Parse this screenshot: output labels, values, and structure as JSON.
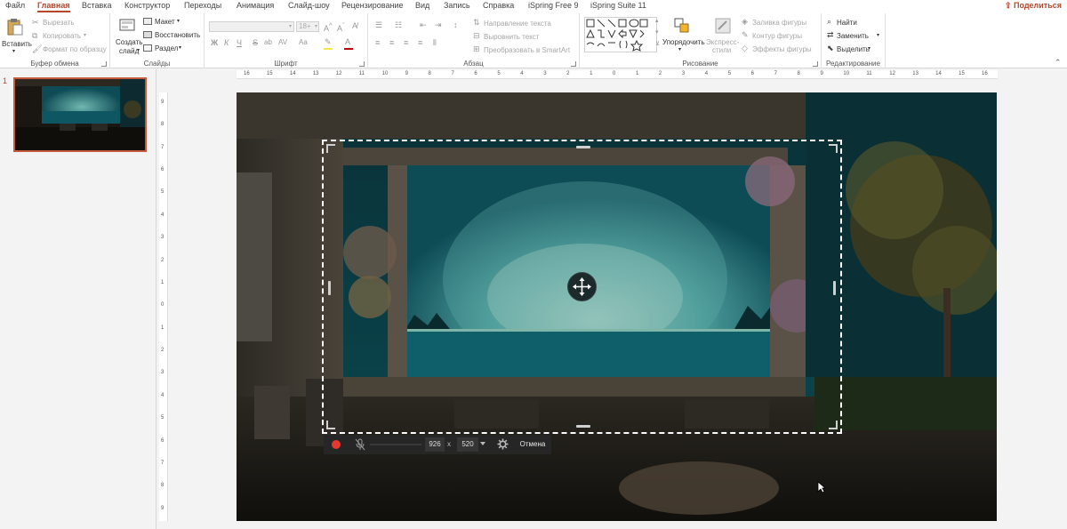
{
  "tabs": {
    "items": [
      "Файл",
      "Главная",
      "Вставка",
      "Конструктор",
      "Переходы",
      "Анимация",
      "Слайд-шоу",
      "Рецензирование",
      "Вид",
      "Запись",
      "Справка",
      "iSpring Free 9",
      "iSpring Suite 11"
    ],
    "active_index": 1,
    "share": "Поделиться"
  },
  "ribbon": {
    "clipboard": {
      "paste": "Вставить",
      "cut": "Вырезать",
      "copy": "Копировать",
      "format_painter": "Формат по образцу",
      "label": "Буфер обмена"
    },
    "slides": {
      "new_slide_line1": "Создать",
      "new_slide_line2": "слайд",
      "layout": "Макет",
      "reset": "Восстановить",
      "section": "Раздел",
      "label": "Слайды"
    },
    "font": {
      "font_size": "18+",
      "bold": "Ж",
      "italic": "К",
      "underline": "Ч",
      "strike": "S",
      "shadow": "ab",
      "spacing": "AV",
      "case": "Aa",
      "label": "Шрифт"
    },
    "paragraph": {
      "text_direction": "Направление текста",
      "align_text": "Выровнить текст",
      "smartart": "Преобразовать в SmartArt",
      "label": "Абзац"
    },
    "drawing": {
      "arrange": "Упорядочить",
      "quick_styles_line1": "Экспресс-",
      "quick_styles_line2": "стили",
      "shape_fill": "Заливка фигуры",
      "shape_outline": "Контур фигуры",
      "shape_effects": "Эффекты фигуры",
      "label": "Рисование"
    },
    "editing": {
      "find": "Найти",
      "replace": "Заменить",
      "select": "Выделить",
      "label": "Редактирование"
    }
  },
  "thumbnails": {
    "slide_number": "1"
  },
  "rulers": {
    "horizontal": [
      "16",
      "15",
      "14",
      "13",
      "12",
      "11",
      "10",
      "9",
      "8",
      "7",
      "6",
      "5",
      "4",
      "3",
      "2",
      "1",
      "0",
      "1",
      "2",
      "3",
      "4",
      "5",
      "6",
      "7",
      "8",
      "9",
      "10",
      "11",
      "12",
      "13",
      "14",
      "15",
      "16"
    ],
    "vertical": [
      "9",
      "8",
      "7",
      "6",
      "5",
      "4",
      "3",
      "2",
      "1",
      "0",
      "1",
      "2",
      "3",
      "4",
      "5",
      "6",
      "7",
      "8",
      "9"
    ]
  },
  "recorder": {
    "width": "926",
    "x_sep": "x",
    "height": "520",
    "cancel": "Отмена"
  },
  "colors": {
    "accent": "#b7472a",
    "record": "#e5392f",
    "toolbar": "#262626"
  }
}
